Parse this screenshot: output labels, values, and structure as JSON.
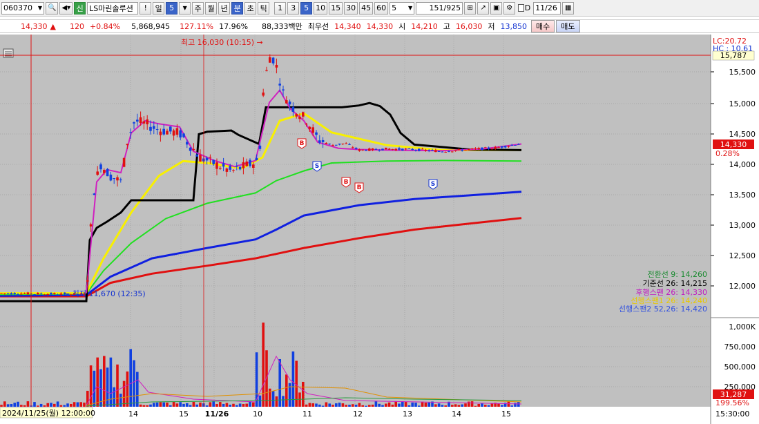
{
  "toolbar": {
    "code": "060370",
    "badge": "신",
    "name": "LS마린솔루션",
    "period_buttons": [
      "일",
      "5",
      "주",
      "월",
      "년",
      "분",
      "초",
      "틱"
    ],
    "interval_buttons": [
      "1",
      "3",
      "5",
      "10",
      "15",
      "30",
      "45",
      "60"
    ],
    "count_select": "5",
    "bar_count": "151",
    "bar_total": "/925",
    "checkbox_label": "D",
    "date_input": "11/26"
  },
  "quote": {
    "price": "14,330",
    "change_arrow": "▲",
    "change": "120",
    "change_pct": "+0.84%",
    "volume": "5,868,945",
    "vol_ratio": "127.11%",
    "turnover": "17.96%",
    "amount": "88,333백만",
    "best_ask_label": "최우선",
    "best_ask": "14,340",
    "best_bid": "14,330",
    "open_label": "시",
    "open": "14,210",
    "high_label": "고",
    "high": "16,030",
    "low_label": "저",
    "low": "13,850",
    "buy_label": "매수",
    "sell_label": "매도"
  },
  "chart_data": {
    "type": "candlestick",
    "y_price_ticks": [
      "15,500",
      "15,000",
      "14,500",
      "14,000",
      "13,500",
      "13,000",
      "12,500",
      "12,000"
    ],
    "ylim": [
      11,
      700,
      16,
      180
    ],
    "y_volume_ticks": [
      "1,000K",
      "750,000",
      "500,000",
      "250,000"
    ],
    "x_ticks": [
      "14",
      "15",
      "11/26",
      "10",
      "11",
      "12",
      "13",
      "14",
      "15"
    ],
    "time_readout": "2024/11/25(월) 12:00:00",
    "right_time": "15:30:00",
    "right_labels": {
      "lc": "LC:20.72",
      "hc": "HC : 10.61",
      "crosshair_price": "15,787",
      "current_price": "14,330",
      "current_pct": "0.28%",
      "volume_current": "31,287",
      "volume_pct": "199.56%"
    },
    "annotations": {
      "high": "최고 16,030 (10:15) →",
      "low": "← 최저 11,670 (12:35)"
    },
    "legend": [
      {
        "text": "전환선 9: 14,260",
        "color": "#1a8a30"
      },
      {
        "text": "기준선 26: 14,215",
        "color": "#000000"
      },
      {
        "text": "후행스팬 26: 14,330",
        "color": "#c01ac0"
      },
      {
        "text": "선행스팬1 26: 14,240",
        "color": "#e8c800"
      },
      {
        "text": "선행스팬2 52,26: 14,420",
        "color": "#3050e0"
      }
    ],
    "signals": [
      {
        "label": "B",
        "x": 437,
        "y": 157
      },
      {
        "label": "S",
        "x": 459,
        "y": 190
      },
      {
        "label": "B",
        "x": 501,
        "y": 213
      },
      {
        "label": "B",
        "x": 520,
        "y": 221
      },
      {
        "label": "S",
        "x": 627,
        "y": 216
      }
    ],
    "colors": {
      "ma_yellow": "#f8f000",
      "ma_green": "#20e020",
      "ma_blue": "#1020e0",
      "ma_red": "#e01010",
      "ma_magenta": "#d020c0",
      "kijun": "#000000",
      "up_candle": "#e01010",
      "down_candle": "#1040e0",
      "background": "#c0c0c0"
    }
  }
}
